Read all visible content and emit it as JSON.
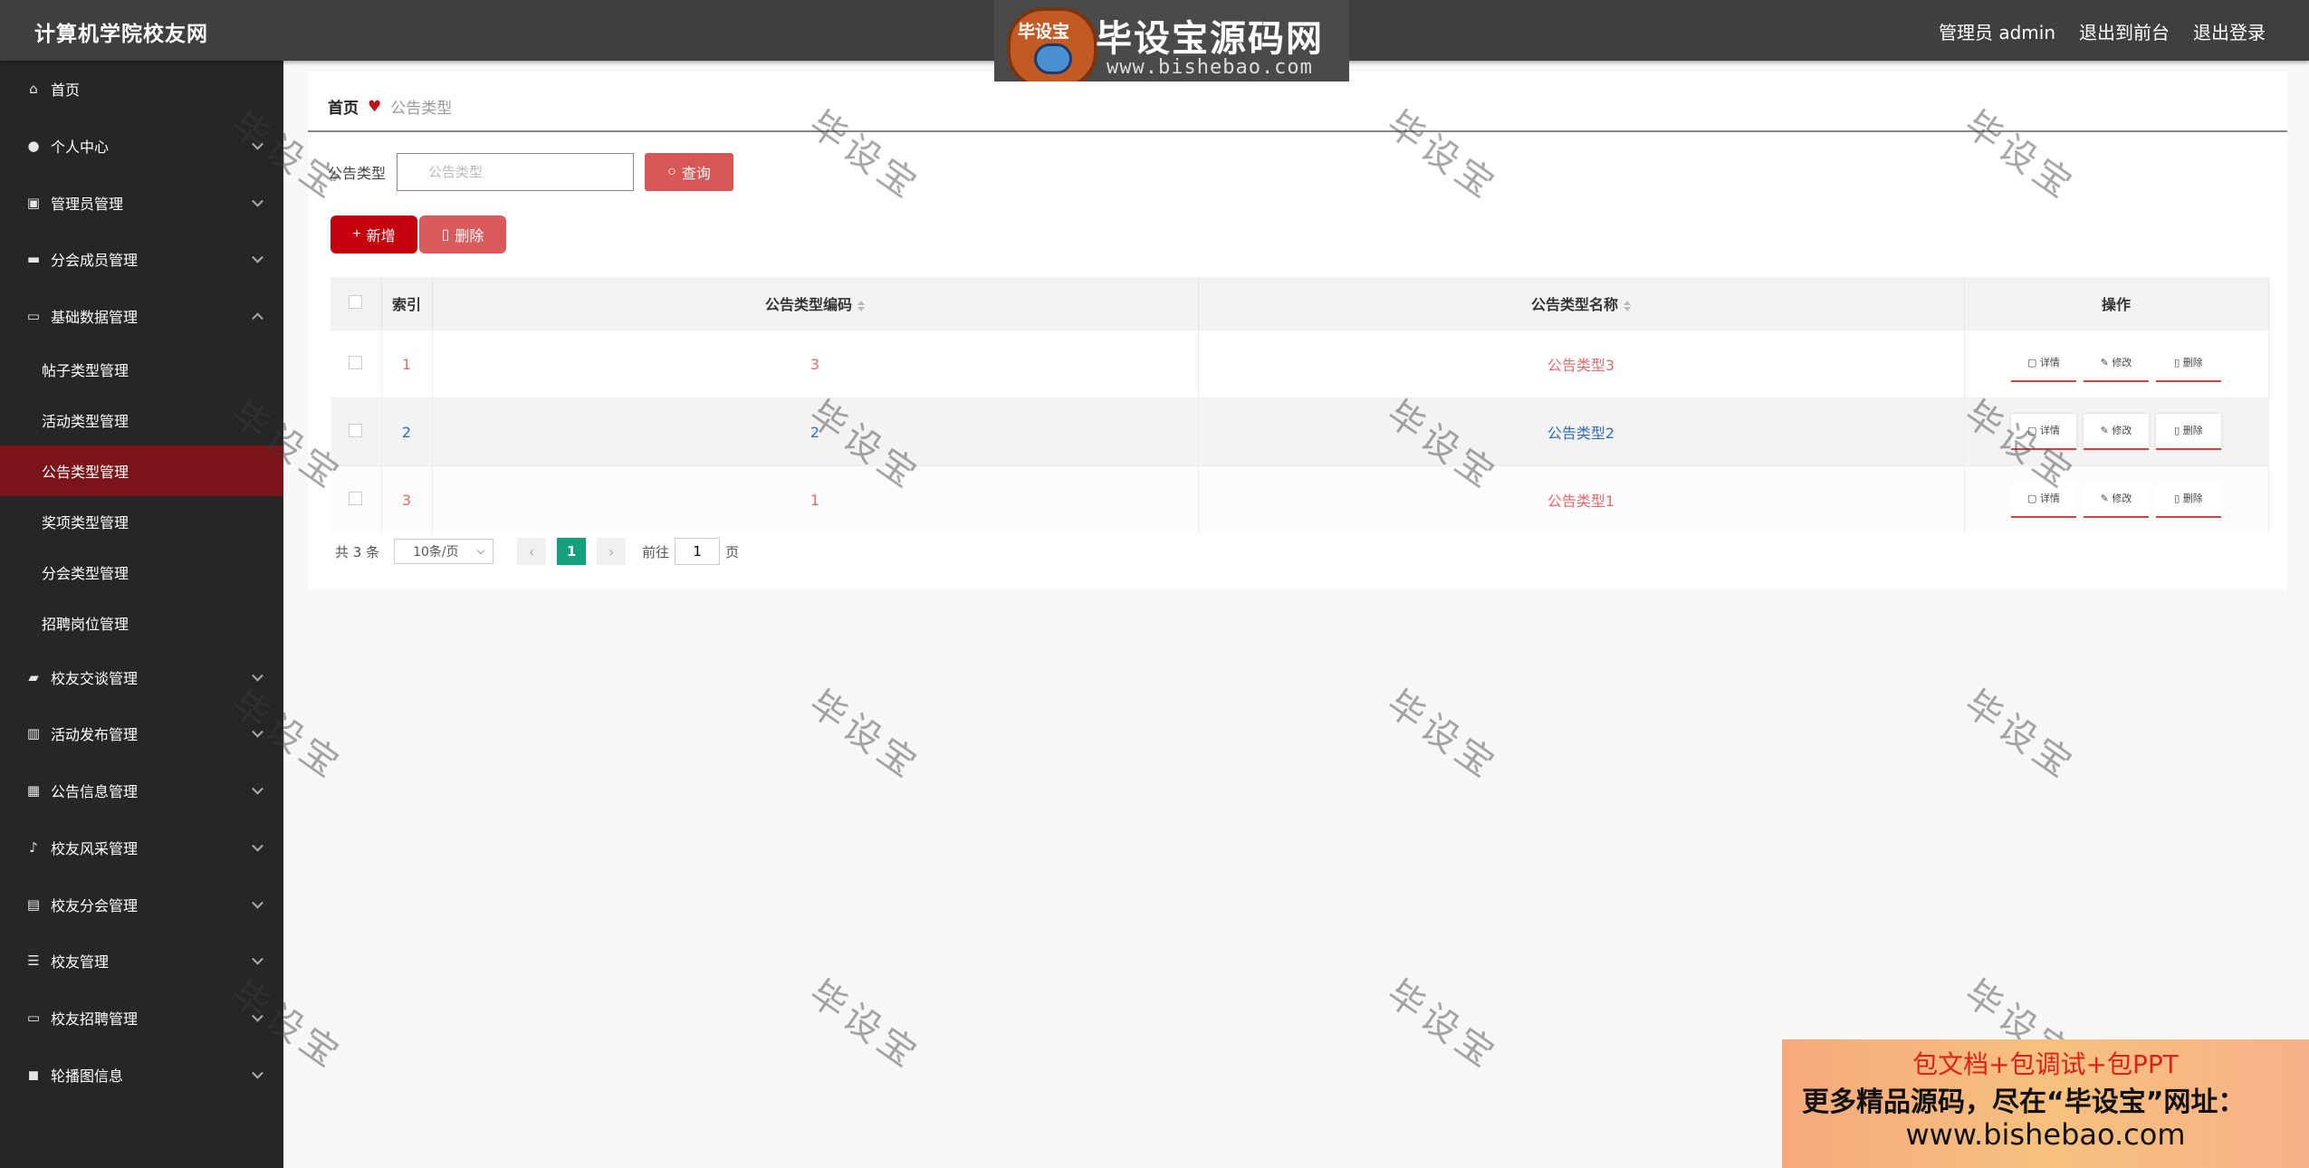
{
  "app_title": "计算机学院校友网",
  "top_links": {
    "admin": "管理员 admin",
    "front": "退出到前台",
    "logout": "退出登录"
  },
  "watermark_logo": {
    "badge": "毕设宝",
    "name": "毕设宝源码网",
    "url": "www.bishebao.com"
  },
  "sidebar": {
    "items": [
      {
        "label": "首页",
        "icon": "home-icon"
      },
      {
        "label": "个人中心",
        "icon": "user-icon"
      },
      {
        "label": "管理员管理",
        "icon": "clipboard-icon"
      },
      {
        "label": "分会成员管理",
        "icon": "chat-icon"
      },
      {
        "label": "基础数据管理",
        "icon": "card-icon"
      }
    ],
    "sub_items": [
      {
        "label": "帖子类型管理"
      },
      {
        "label": "活动类型管理"
      },
      {
        "label": "公告类型管理",
        "active": true
      },
      {
        "label": "奖项类型管理"
      },
      {
        "label": "分会类型管理"
      },
      {
        "label": "招聘岗位管理"
      }
    ],
    "items2": [
      {
        "label": "校友交谈管理",
        "icon": "briefcase-icon"
      },
      {
        "label": "活动发布管理",
        "icon": "bar-icon"
      },
      {
        "label": "公告信息管理",
        "icon": "grid-icon"
      },
      {
        "label": "校友风采管理",
        "icon": "mic-icon"
      },
      {
        "label": "校友分会管理",
        "icon": "clipboard2-icon"
      },
      {
        "label": "校友管理",
        "icon": "list-icon"
      },
      {
        "label": "校友招聘管理",
        "icon": "monitor-icon"
      },
      {
        "label": "轮播图信息",
        "icon": "camera-icon"
      }
    ]
  },
  "breadcrumb": {
    "home": "首页",
    "current": "公告类型"
  },
  "search": {
    "label": "公告类型",
    "placeholder": "公告类型",
    "button": "查询"
  },
  "actions": {
    "add": "新增",
    "delete": "删除"
  },
  "table": {
    "headers": {
      "index": "索引",
      "code": "公告类型编码",
      "name": "公告类型名称",
      "ops": "操作"
    },
    "rows": [
      {
        "index": "1",
        "code": "3",
        "name": "公告类型3"
      },
      {
        "index": "2",
        "code": "2",
        "name": "公告类型2"
      },
      {
        "index": "3",
        "code": "1",
        "name": "公告类型1"
      }
    ],
    "op_labels": {
      "detail": "详情",
      "edit": "修改",
      "delete": "删除"
    }
  },
  "pager": {
    "total": "共 3 条",
    "size": "10条/页",
    "page": "1",
    "goto": "前往",
    "goto_value": "1",
    "page_unit": "页"
  },
  "watermark": "毕设宝",
  "ad": {
    "line1": "包文档+包调试+包PPT",
    "line2": "更多精品源码，尽在“毕设宝”网址：",
    "line3": "www.bishebao.com"
  },
  "colors": {
    "accent": "#c3000b",
    "active_menu": "#7a1418",
    "pager_active": "#13a07b"
  }
}
